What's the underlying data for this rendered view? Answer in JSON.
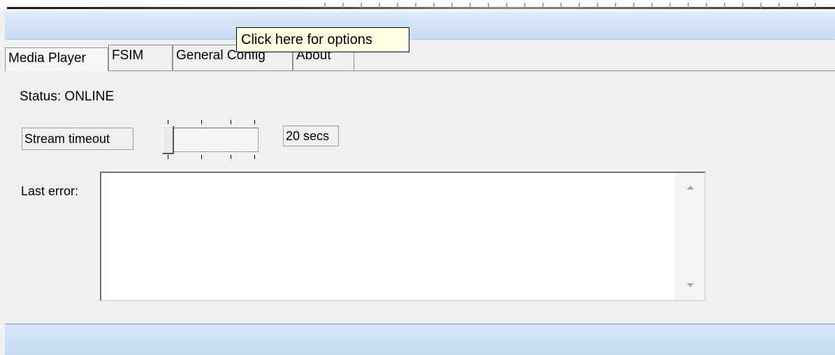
{
  "tooltip": {
    "text": "Click here for options"
  },
  "tabs": [
    {
      "label": "Media Player",
      "active": true
    },
    {
      "label": "FSIM",
      "active": false
    },
    {
      "label": "General Config",
      "active": false
    },
    {
      "label": "About",
      "active": false
    }
  ],
  "media_player": {
    "status": "Status: ONLINE",
    "stream_timeout_label": "Stream timeout",
    "stream_timeout_value": "20 secs",
    "last_error_label": "Last error:",
    "last_error_text": ""
  },
  "colors": {
    "titlebar": "#dce9f8",
    "tooltip_bg": "#ffffe1",
    "window_bg": "#f0f0f0"
  },
  "icons": {
    "scroll_up": "scroll-up-arrow-icon",
    "scroll_down": "scroll-down-arrow-icon"
  }
}
